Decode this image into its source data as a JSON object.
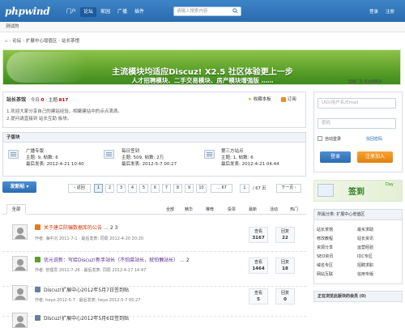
{
  "topbar": {
    "logo": "phpwind",
    "nav": [
      "门户",
      "论坛",
      "家园",
      "广播",
      "插件"
    ],
    "search_placeholder": "请输入搜索内容",
    "links": [
      "登录",
      "注册"
    ]
  },
  "hint": "测试的",
  "breadcrumb": [
    "论坛",
    "扩展中心增值区",
    "站长茶馆"
  ],
  "banner": {
    "line1": "主流模块均适应Discuz! X2.5 社区体验更上一步",
    "line2": "人才招聘模块、二手交易模块、房产模块增强版 ……",
    "ad_label": "自助广告 可立即购买"
  },
  "forum": {
    "name": "站长茶馆",
    "today_label": "今日:",
    "today": "0",
    "topics_label": "主题:",
    "topics": "817",
    "fav": "收藏本板",
    "rss": "订阅",
    "desc1": "1.欢迎大家分享自己的建站经验，相聚建站中的点点滴滴。",
    "desc2": "2.提问请直接到 站长互助 板块。"
  },
  "subforums": {
    "header": "子版块",
    "items": [
      {
        "name": "广播专版",
        "stats": "主题: 9, 帖数: 6",
        "last": "最后发表: 2012-4-21 10:40"
      },
      {
        "name": "每日签到",
        "stats": "主题: 509, 帖数: 2万",
        "last": "最后发表: 2012-5-7 00:27"
      },
      {
        "name": "第三方站点",
        "stats": "主题: 1, 帖数: 6",
        "last": "最后发表: 2012-4-21 04:44"
      }
    ]
  },
  "pager": {
    "new_post": "发新帖",
    "prev": "返回",
    "pages": [
      "1",
      "2",
      "3",
      "4",
      "5",
      "6",
      "7",
      "8",
      "9",
      "10",
      "... 67"
    ],
    "page_input": "1",
    "total": "/ 67 页",
    "next": "下一页"
  },
  "filters": {
    "all_tab": "全部",
    "items": [
      "全部",
      "精华",
      "推荐",
      "投票",
      "最新",
      "活动",
      "热门"
    ]
  },
  "threads": [
    {
      "title": "关于建立防骗数据库的公告",
      "pages": "… 2 3",
      "author": "作者: 海中沉 2011-7-1",
      "last": "最后发表: 同局 2012-4-20 20:20",
      "views_label": "查看",
      "views": "3167",
      "replies_label": "回复",
      "replies": "22",
      "icon_color": "#e07b1d"
    },
    {
      "title": "优元说新：写给Discuz!新手站长（不怕菜站长，就怕懒站长）",
      "pages": "… 2",
      "author": "作者: 管理员 2011-7-26",
      "last": "最后发表: 同局 2012-4-17 14:47",
      "views_label": "查看",
      "views": "1464",
      "replies_label": "回复",
      "replies": "18",
      "icon_color": "#5a9e2e"
    },
    {
      "title": "Discuz!扩展中心2012年5月7日签到贴",
      "pages": "",
      "author": "作者: heyo 2012-5-7",
      "last": "最后发表: heyo 2012-5-7 00:27",
      "views_label": "查看",
      "views": "5",
      "replies_label": "回复",
      "replies": "0",
      "icon_color": "#6b7f99"
    },
    {
      "title": "Discuz!扩展中心2012年5月6日签到贴",
      "pages": "",
      "author": "",
      "last": "",
      "views_label": "查看",
      "views": "",
      "replies_label": "回复",
      "replies": "",
      "icon_color": "#6b7f99"
    }
  ],
  "login": {
    "user_placeholder": "UID/用户名/Email",
    "pass_placeholder": "密码",
    "auto": "自动登录",
    "forgot": "找回密码",
    "login": "登录",
    "register": "注册加入"
  },
  "sidead": {
    "text": "签到",
    "sub": "Day"
  },
  "manage": {
    "header": "所属分类: 扩展中心增值区",
    "links": [
      "站长茶馆",
      "最买求助",
      "修改教程",
      "站长资讯",
      "资源分享",
      "运营经验",
      "SEO资讯",
      "IDC专区",
      "域名专区",
      "招聘求职",
      "网站互联",
      "信用专版"
    ]
  },
  "online": {
    "header": "正在浏览此版块的会员 (0)"
  }
}
